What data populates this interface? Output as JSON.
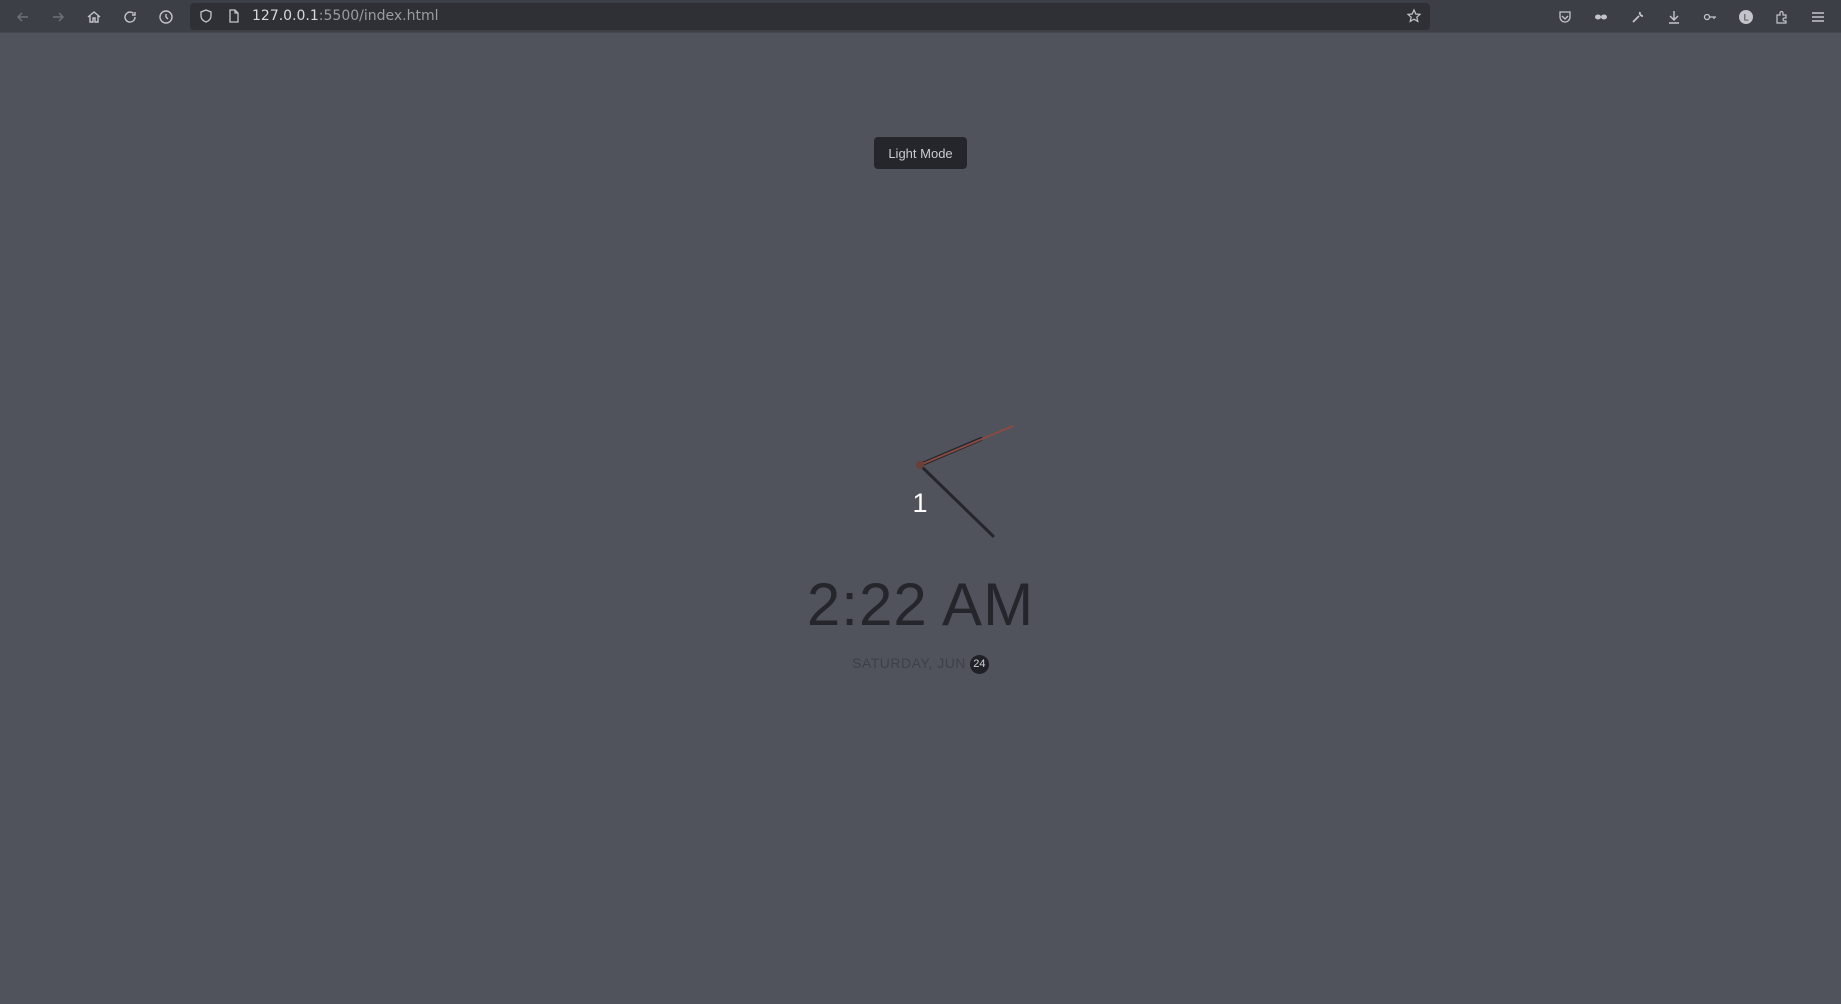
{
  "browser": {
    "url_host": "127.0.0.1",
    "url_rest": ":5500/index.html",
    "toolbar_icons": [
      "back-arrow-icon",
      "forward-arrow-icon",
      "home-icon",
      "reload-icon",
      "history-icon",
      "shield-icon",
      "page-icon",
      "star-icon",
      "pocket-icon",
      "mask-icon",
      "wrench-icon",
      "download-icon",
      "key-icon",
      "account-icon",
      "extensions-icon",
      "menu-icon"
    ]
  },
  "page": {
    "mode_button_label": "Light Mode",
    "clock_number": "1",
    "time": "2:22 AM",
    "date_text": "SATURDAY, JUN",
    "day": "24"
  },
  "colors": {
    "background": "#50535c",
    "hand": "#24262c",
    "second_hand": "#8a4a42",
    "numeral": "#ffffff"
  }
}
